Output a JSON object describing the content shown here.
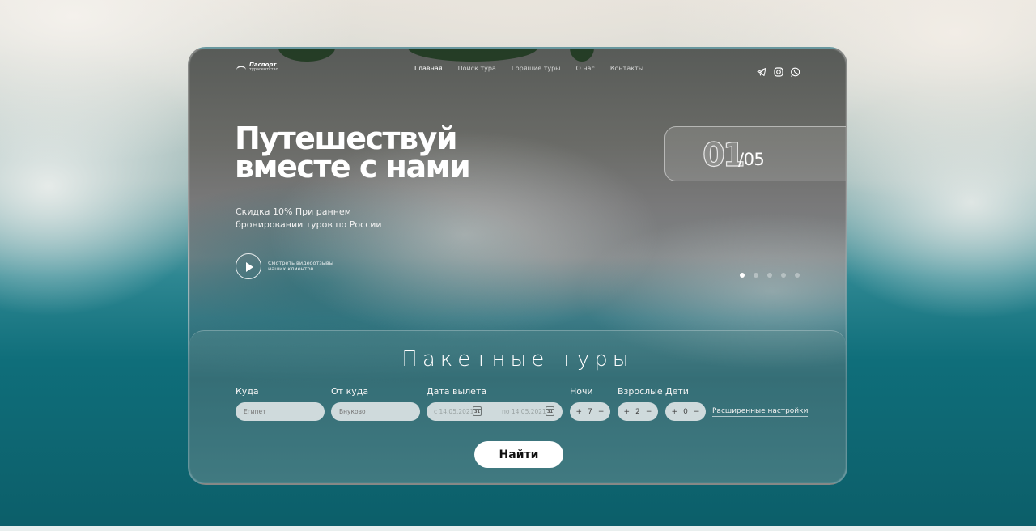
{
  "brand": {
    "name": "Паспорт",
    "subtitle": "турагентство"
  },
  "nav": {
    "items": [
      "Главная",
      "Поиск тура",
      "Горящие туры",
      "О нас",
      "Контакты"
    ],
    "active": 0
  },
  "social": [
    "telegram-icon",
    "instagram-icon",
    "whatsapp-icon"
  ],
  "hero": {
    "title_line1": "Путешествуй",
    "title_line2": "вместе с нами",
    "subtitle": "Скидка 10% При раннем бронировании туров по России",
    "video_text": "Смотреть видеоотзывы наших клиентов"
  },
  "slider": {
    "current": "01",
    "total": "/05",
    "count": 5,
    "active_index": 0
  },
  "search": {
    "title": "Пакетные туры",
    "labels": {
      "to": "Куда",
      "from": "От куда",
      "date": "Дата вылета",
      "nights": "Ночи",
      "adults": "Взрослые",
      "children": "Дети"
    },
    "to_placeholder": "Египет",
    "from_placeholder": "Внуково",
    "date_from": "с 14.05.2021",
    "date_to": "по 14.05.2021",
    "calendar_day": "31",
    "nights": {
      "plus": "+",
      "value": "7",
      "minus": "−"
    },
    "adults": {
      "plus": "+",
      "value": "2",
      "minus": "−"
    },
    "children": {
      "plus": "+",
      "value": "0",
      "minus": "−"
    },
    "advanced": "Расширенные настройки",
    "submit": "Найти"
  }
}
